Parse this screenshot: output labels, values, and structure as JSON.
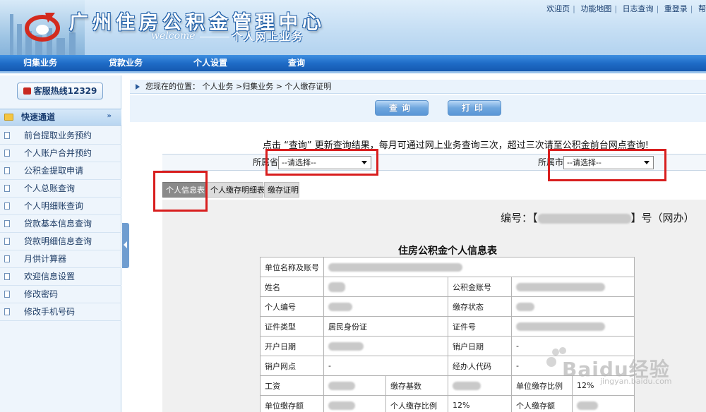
{
  "header": {
    "site_title": "广州住房公积金管理中心",
    "welcome": "welcome",
    "subtitle": "个人网上业务",
    "top_links": [
      "欢迎页",
      "功能地图",
      "日志查询",
      "重登录",
      "帮"
    ]
  },
  "nav": {
    "items": [
      "归集业务",
      "贷款业务",
      "个人设置",
      "查询"
    ]
  },
  "sidebar": {
    "hotline": "客服热线12329",
    "quick_title": "快速通道",
    "items": [
      "前台提取业务预约",
      "个人账户合并预约",
      "公积金提取申请",
      "个人总账查询",
      "个人明细账查询",
      "贷款基本信息查询",
      "贷款明细信息查询",
      "月供计算器",
      "欢迎信息设置",
      "修改密码",
      "修改手机号码"
    ]
  },
  "breadcrumb": "您现在的位置： 个人业务 >归集业务 > 个人缴存证明",
  "actions": {
    "query": "查询",
    "print": "打印"
  },
  "notice": "点击 “查询” 更新查询结果，每月可通过网上业务查询三次，超过三次请至公积金前台网点查询!",
  "filters": {
    "province_label": "所属省",
    "province_value": "--请选择--",
    "city_label": "所属市",
    "city_value": "--请选择--"
  },
  "tabs": [
    "个人信息表",
    "个人缴存明细表",
    "缴存证明"
  ],
  "doc_number": {
    "prefix": "编号：【",
    "suffix": "】号（网办）"
  },
  "form": {
    "title": "住房公积金个人信息表",
    "rows": [
      {
        "l1": "单位名称及账号"
      },
      {
        "l1": "姓名",
        "l2": "公积金账号"
      },
      {
        "l1": "个人编号",
        "l2": "缴存状态"
      },
      {
        "l1": "证件类型",
        "v1": "居民身份证",
        "l2": "证件号"
      },
      {
        "l1": "开户日期",
        "l2": "销户日期",
        "v2": "-"
      },
      {
        "l1": "销户网点",
        "v1": "-",
        "l2": "经办人代码",
        "v2": "-"
      },
      {
        "l1": "工资",
        "l2": "缴存基数",
        "l3": "单位缴存比例",
        "v3": "12%"
      },
      {
        "l1": "单位缴存额",
        "l2": "个人缴存比例",
        "v2": "12%",
        "l3": "个人缴存额"
      }
    ]
  },
  "watermark": {
    "text": "Baidu经验",
    "url": "jingyan.baidu.com"
  }
}
